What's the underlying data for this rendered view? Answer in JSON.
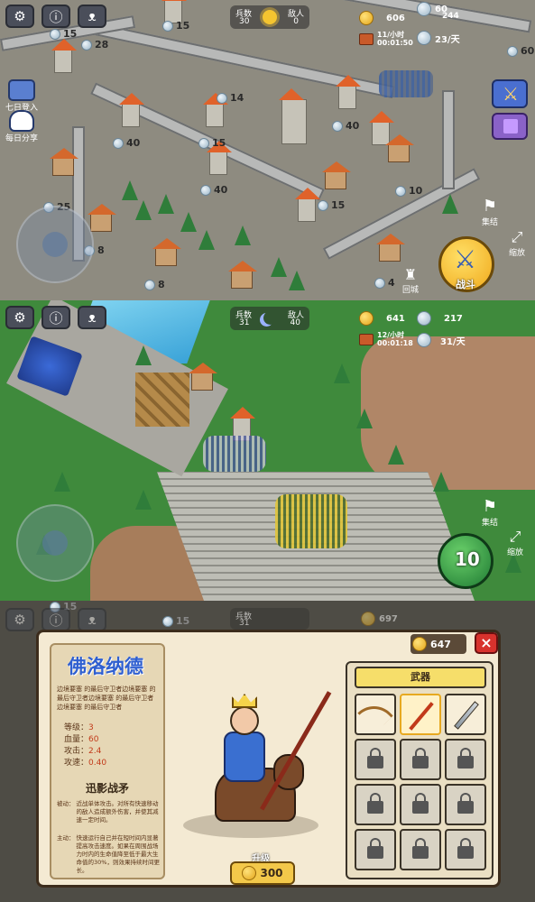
{
  "panel1": {
    "hud": {
      "troops_label": "兵数",
      "troops": "30",
      "enemies_label": "敌人",
      "enemies": "0"
    },
    "gold": "606",
    "gems": "60",
    "chest_rate": "11/小时",
    "chest_time": "00:01:50",
    "gem_total": "244",
    "gem_rate": "23/天",
    "gem_right": "60",
    "side_left": [
      {
        "label": "七日登入"
      },
      {
        "label": "每日分享"
      }
    ],
    "counts": [
      "15",
      "15",
      "28",
      "14",
      "40",
      "40",
      "15",
      "40",
      "25",
      "8",
      "8",
      "15",
      "10",
      "4",
      "40"
    ],
    "gather_label": "集结",
    "zoom_label": "缩放",
    "home_label": "回城",
    "fight_label": "战斗"
  },
  "panel2": {
    "hud": {
      "troops_label": "兵数",
      "troops": "31",
      "enemies_label": "敌人",
      "enemies": "40"
    },
    "gold": "641",
    "gems": "217",
    "chest_rate": "12/小时",
    "chest_time": "00:01:18",
    "gem_rate": "31/天",
    "gather_label": "集结",
    "zoom_label": "缩放",
    "army_count": "10"
  },
  "panel3": {
    "bg_counts": [
      "15",
      "15",
      "697"
    ],
    "hud": {
      "troops_label": "兵数",
      "troops": "31"
    },
    "modal": {
      "gold": "647",
      "hero_name": "佛洛纳德",
      "description": "边境要塞 的最后守卫者边境要塞 的最后守卫者边境要塞 的最后守卫者边境要塞 的最后守卫者",
      "stats": [
        {
          "label": "等级：",
          "value": "3"
        },
        {
          "label": "血量：",
          "value": "60"
        },
        {
          "label": "攻击：",
          "value": "2.4"
        },
        {
          "label": "攻速：",
          "value": "0.40"
        }
      ],
      "skill_name": "迅影战矛",
      "passive_label": "被动：",
      "passive_text": "近战单体攻击。对所有快速移动的敌人造成额外伤害，并使其减速一定时间。",
      "active_label": "主动：",
      "active_text": "快速运行自己并在短时间内显著提高攻击速度。如果在周围战场力时内的生命值降至低于最大生命值的30%，则效果持续时间更长。",
      "upgrade_label": "升级",
      "upgrade_cost": "300",
      "weapons_tab": "武器",
      "close": "×"
    }
  },
  "colors": {
    "accent": "#e7a921",
    "close": "#d8322d",
    "dark": "#3c2c1c",
    "modal_bg": "#f4ead3"
  }
}
